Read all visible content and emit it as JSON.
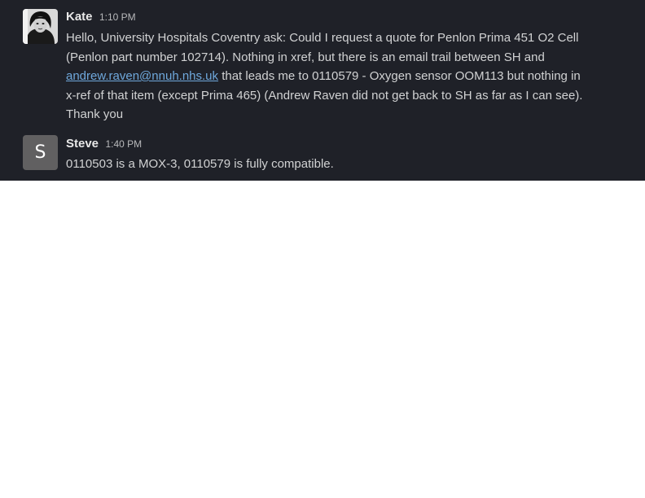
{
  "messages": [
    {
      "author": "Kate",
      "time": "1:10 PM",
      "avatar_icon": "profile-photo",
      "lines": {
        "l1": "Hello, University Hospitals Coventry ask: Could I request a quote for Penlon Prima 451 O2 Cell",
        "l2": "(Penlon part number 102714). Nothing in xref, but there is an email trail between SH and",
        "l3_link": "andrew.raven@nnuh.nhs.uk",
        "l3_rest": " that leads me to 0110579 - Oxygen sensor OOM113 but nothing in",
        "l4": "x-ref of that item (except Prima 465) (Andrew Raven did not get back to SH as far as I can see).",
        "l5": "Thank you"
      }
    },
    {
      "author": "Steve",
      "time": "1:40 PM",
      "avatar_initial": "S",
      "avatar_color": "#616061",
      "text": "0110503 is a MOX-3, 0110579 is fully compatible."
    }
  ],
  "colors": {
    "background": "#1f2128",
    "text": "#d1d2d3",
    "link": "#6fa8dc"
  }
}
